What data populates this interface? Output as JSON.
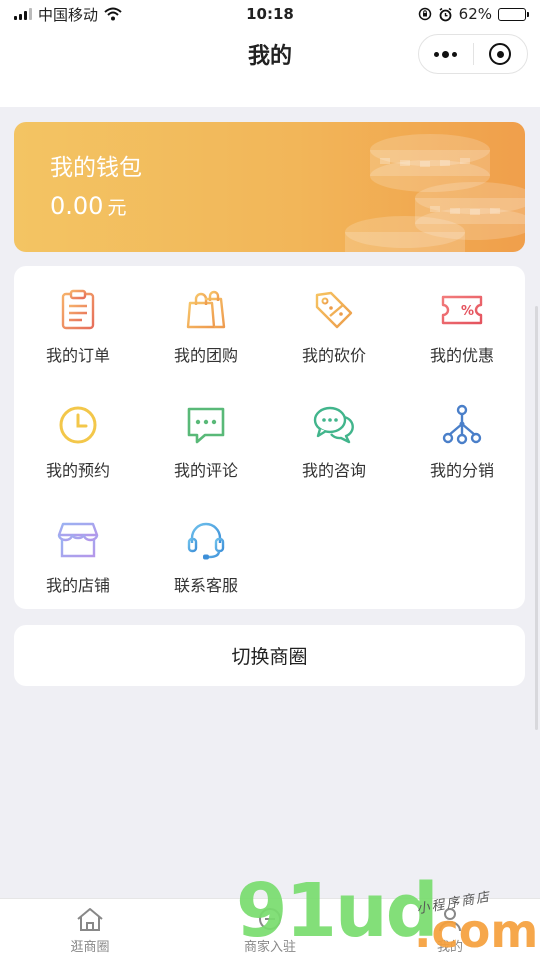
{
  "status": {
    "carrier": "中国移动",
    "time": "10:18",
    "battery_percent": "62%",
    "battery_level": 0.62
  },
  "nav": {
    "title": "我的"
  },
  "wallet": {
    "title": "我的钱包",
    "amount": "0.00",
    "unit": "元"
  },
  "menu": {
    "items": [
      {
        "label": "我的订单",
        "icon": "clipboard-icon"
      },
      {
        "label": "我的团购",
        "icon": "shopping-bag-icon"
      },
      {
        "label": "我的砍价",
        "icon": "price-tag-icon"
      },
      {
        "label": "我的优惠",
        "icon": "coupon-icon"
      },
      {
        "label": "我的预约",
        "icon": "clock-icon"
      },
      {
        "label": "我的评论",
        "icon": "comment-icon"
      },
      {
        "label": "我的咨询",
        "icon": "chat-icon"
      },
      {
        "label": "我的分销",
        "icon": "hierarchy-icon"
      },
      {
        "label": "我的店铺",
        "icon": "store-icon"
      },
      {
        "label": "联系客服",
        "icon": "headset-icon"
      }
    ]
  },
  "switch": {
    "label": "切换商圈"
  },
  "tabs": [
    {
      "label": "逛商圈",
      "icon": "home-icon"
    },
    {
      "label": "商家入驻",
      "icon": "store-entry-icon"
    },
    {
      "label": "我的",
      "icon": "profile-icon"
    }
  ],
  "watermark": {
    "text": "91ud",
    "suffix": ".com",
    "tagline": "小程序商店"
  },
  "colors": {
    "wallet_start": "#f3c463",
    "wallet_end": "#f09f4b",
    "background": "#efeff4"
  }
}
